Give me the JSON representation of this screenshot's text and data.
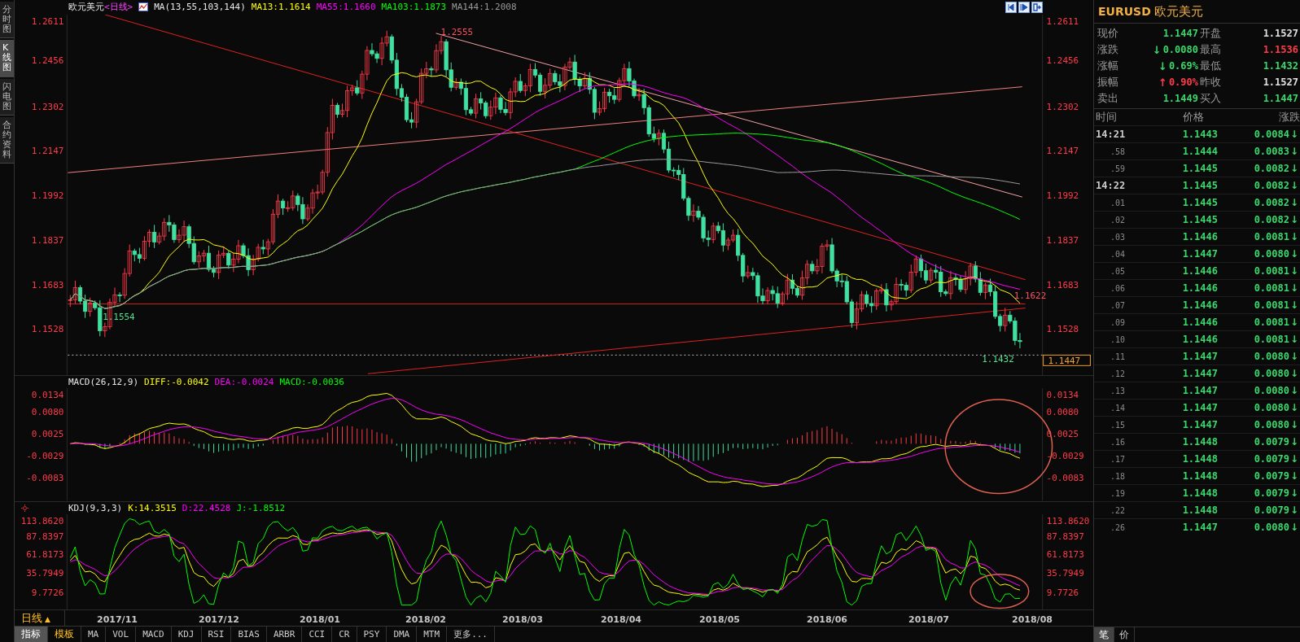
{
  "sidebar": {
    "tabs": [
      {
        "label": "分时图",
        "selected": false
      },
      {
        "label": "K线图",
        "selected": true
      },
      {
        "label": "闪电图",
        "selected": false
      },
      {
        "label": "合约资料",
        "selected": false
      }
    ]
  },
  "price_chart": {
    "title": "欧元美元",
    "period": "<日线>",
    "indicator": "MA(13,55,103,144)",
    "ma_values": [
      {
        "label": "MA13:1.1614",
        "color": "#ffff00"
      },
      {
        "label": "MA55:1.1660",
        "color": "#ff00ff"
      },
      {
        "label": "MA103:1.1873",
        "color": "#00ff00"
      },
      {
        "label": "MA144:1.2008",
        "color": "#9a9a9a"
      }
    ],
    "left_axis_labels": [
      "1.2611",
      "1.2456",
      "1.2302",
      "1.2147",
      "1.1992",
      "1.1837",
      "1.1683",
      "1.1528"
    ],
    "right_axis_labels": [
      "1.2611",
      "1.2456",
      "1.2302",
      "1.2147",
      "1.1992",
      "1.1837",
      "1.1683",
      "1.1528"
    ],
    "price_labels": [
      "1.2555",
      "1.1554",
      "1.1432",
      "1.1622"
    ],
    "current_price": "1.1447"
  },
  "macd_chart": {
    "indicator": "MACD(26,12,9)",
    "values": [
      {
        "label": "DIFF:-0.0042",
        "color": "#ffff00"
      },
      {
        "label": "DEA:-0.0024",
        "color": "#ff00ff"
      },
      {
        "label": "MACD:-0.0036",
        "color": "#00ff00"
      }
    ],
    "left_axis_labels": [
      "0.0134",
      "0.0080",
      "0.0025",
      "-0.0029",
      "-0.0083"
    ],
    "right_axis_labels": [
      "0.0134",
      "0.0080",
      "0.0025",
      "-0.0029",
      "-0.0083"
    ]
  },
  "kdj_chart": {
    "indicator": "KDJ(9,3,3)",
    "values": [
      {
        "label": "K:14.3515",
        "color": "#ffff00"
      },
      {
        "label": "D:22.4528",
        "color": "#ff00ff"
      },
      {
        "label": "J:-1.8512",
        "color": "#00ff00"
      }
    ],
    "left_axis_labels": [
      "113.8620",
      "87.8397",
      "61.8173",
      "35.7949",
      "9.7726"
    ],
    "right_axis_labels": [
      "113.8620",
      "87.8397",
      "61.8173",
      "35.7949",
      "9.7726"
    ]
  },
  "x_axis": {
    "period_button": {
      "label": "日线",
      "arrow": "▲"
    },
    "dates": [
      "2017/11",
      "2017/12",
      "2018/01",
      "2018/02",
      "2018/03",
      "2018/04",
      "2018/05",
      "2018/06",
      "2018/07",
      "2018/08"
    ]
  },
  "bottom_tabs": {
    "panel_tabs": [
      {
        "label": "指标",
        "selected": true
      },
      {
        "label": "模板",
        "selected": false
      }
    ],
    "indicator_tabs": [
      {
        "label": "MA",
        "selected": false
      },
      {
        "label": "VOL",
        "selected": false
      },
      {
        "label": "MACD",
        "selected": false
      },
      {
        "label": "KDJ",
        "selected": false
      },
      {
        "label": "RSI",
        "selected": false
      },
      {
        "label": "BIAS",
        "selected": false
      },
      {
        "label": "ARBR",
        "selected": false
      },
      {
        "label": "CCI",
        "selected": false
      },
      {
        "label": "CR",
        "selected": false
      },
      {
        "label": "PSY",
        "selected": false
      },
      {
        "label": "DMA",
        "selected": false
      },
      {
        "label": "MTM",
        "selected": false
      },
      {
        "label": "更多...",
        "selected": false
      }
    ]
  },
  "quote_panel": {
    "symbol": "EURUSD",
    "name": "欧元美元",
    "rows": [
      {
        "left": {
          "label": "现价",
          "value": "1.1447",
          "color": "#3ad76a"
        },
        "right": {
          "label": "开盘",
          "value": "1.1527",
          "color": "#e0e0e0"
        }
      },
      {
        "left": {
          "label": "涨跌",
          "value": "0.0080",
          "color": "#3ad76a",
          "arrow": "↓"
        },
        "right": {
          "label": "最高",
          "value": "1.1536",
          "color": "#ff3b4a"
        }
      },
      {
        "left": {
          "label": "涨幅",
          "value": "0.69%",
          "color": "#3ad76a",
          "arrow": "↓"
        },
        "right": {
          "label": "最低",
          "value": "1.1432",
          "color": "#3ad76a"
        }
      },
      {
        "left": {
          "label": "振幅",
          "value": "0.90%",
          "color": "#ff3b4a",
          "arrow": "↑"
        },
        "right": {
          "label": "昨收",
          "value": "1.1527",
          "color": "#e0e0e0"
        }
      },
      {
        "left": {
          "label": "卖出",
          "value": "1.1449",
          "color": "#3ad76a"
        },
        "right": {
          "label": "买入",
          "value": "1.1447",
          "color": "#3ad76a"
        }
      }
    ],
    "columns": [
      "时间",
      "价格",
      "涨跌"
    ],
    "ticks": [
      {
        "time": "14:21",
        "kind": "minute",
        "price": "1.1443",
        "change": "0.0084",
        "arrow": "↓"
      },
      {
        "time": ".58",
        "kind": "second",
        "price": "1.1444",
        "change": "0.0083",
        "arrow": "↓"
      },
      {
        "time": ".59",
        "kind": "second",
        "price": "1.1445",
        "change": "0.0082",
        "arrow": "↓"
      },
      {
        "time": "14:22",
        "kind": "minute",
        "price": "1.1445",
        "change": "0.0082",
        "arrow": "↓"
      },
      {
        "time": ".01",
        "kind": "second",
        "price": "1.1445",
        "change": "0.0082",
        "arrow": "↓"
      },
      {
        "time": ".02",
        "kind": "second",
        "price": "1.1445",
        "change": "0.0082",
        "arrow": "↓"
      },
      {
        "time": ".03",
        "kind": "second",
        "price": "1.1446",
        "change": "0.0081",
        "arrow": "↓"
      },
      {
        "time": ".04",
        "kind": "second",
        "price": "1.1447",
        "change": "0.0080",
        "arrow": "↓"
      },
      {
        "time": ".05",
        "kind": "second",
        "price": "1.1446",
        "change": "0.0081",
        "arrow": "↓"
      },
      {
        "time": ".06",
        "kind": "second",
        "price": "1.1446",
        "change": "0.0081",
        "arrow": "↓"
      },
      {
        "time": ".07",
        "kind": "second",
        "price": "1.1446",
        "change": "0.0081",
        "arrow": "↓"
      },
      {
        "time": ".09",
        "kind": "second",
        "price": "1.1446",
        "change": "0.0081",
        "arrow": "↓"
      },
      {
        "time": ".10",
        "kind": "second",
        "price": "1.1446",
        "change": "0.0081",
        "arrow": "↓"
      },
      {
        "time": ".11",
        "kind": "second",
        "price": "1.1447",
        "change": "0.0080",
        "arrow": "↓"
      },
      {
        "time": ".12",
        "kind": "second",
        "price": "1.1447",
        "change": "0.0080",
        "arrow": "↓"
      },
      {
        "time": ".13",
        "kind": "second",
        "price": "1.1447",
        "change": "0.0080",
        "arrow": "↓"
      },
      {
        "time": ".14",
        "kind": "second",
        "price": "1.1447",
        "change": "0.0080",
        "arrow": "↓"
      },
      {
        "time": ".15",
        "kind": "second",
        "price": "1.1447",
        "change": "0.0080",
        "arrow": "↓"
      },
      {
        "time": ".16",
        "kind": "second",
        "price": "1.1448",
        "change": "0.0079",
        "arrow": "↓"
      },
      {
        "time": ".17",
        "kind": "second",
        "price": "1.1448",
        "change": "0.0079",
        "arrow": "↓"
      },
      {
        "time": ".18",
        "kind": "second",
        "price": "1.1448",
        "change": "0.0079",
        "arrow": "↓"
      },
      {
        "time": ".19",
        "kind": "second",
        "price": "1.1448",
        "change": "0.0079",
        "arrow": "↓"
      },
      {
        "time": ".22",
        "kind": "second",
        "price": "1.1448",
        "change": "0.0079",
        "arrow": "↓"
      },
      {
        "time": ".26",
        "kind": "second",
        "price": "1.1447",
        "change": "0.0080",
        "arrow": "↓"
      }
    ],
    "tabs": [
      {
        "label": "笔",
        "selected": true
      },
      {
        "label": "价",
        "selected": false
      }
    ]
  }
}
